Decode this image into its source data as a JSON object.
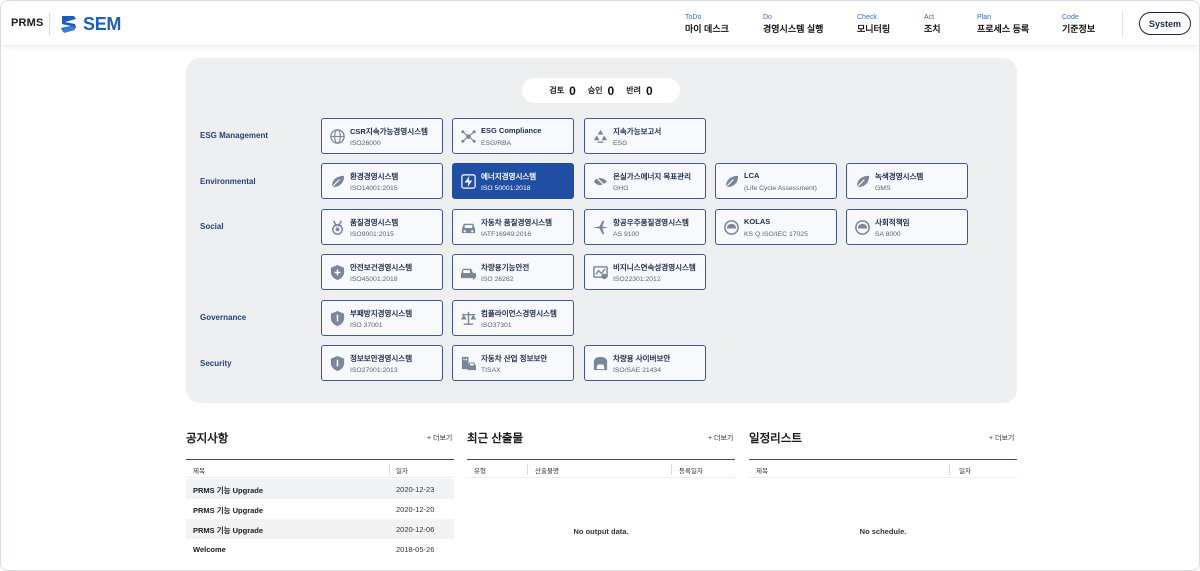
{
  "header": {
    "logo_text": "PRMS",
    "brand_text": "SEM",
    "nav": [
      {
        "en": "ToDo",
        "ko": "마이 데스크"
      },
      {
        "en": "Do",
        "ko": "경영시스템 실행"
      },
      {
        "en": "Check",
        "ko": "모니터링"
      },
      {
        "en": "Act",
        "ko": "조치"
      },
      {
        "en": "Plan",
        "ko": "프로세스 등록"
      },
      {
        "en": "Code",
        "ko": "기준정보"
      }
    ],
    "system_label": "System"
  },
  "counter": [
    {
      "label": "검토",
      "value": "0"
    },
    {
      "label": "승인",
      "value": "0"
    },
    {
      "label": "반려",
      "value": "0"
    }
  ],
  "categories": [
    "ESG Management",
    "Environmental",
    "Social",
    "Governance",
    "Security"
  ],
  "cards": [
    {
      "title": "CSR지속가능경영시스템",
      "code": "ISO26000",
      "icon": "globe-icon"
    },
    {
      "title": "ESG Compliance",
      "code": "ESG/RBA",
      "icon": "network-icon"
    },
    {
      "title": "지속가능보고서",
      "code": "ESG",
      "icon": "recycle-icon"
    },
    {
      "title": "환경경영시스템",
      "code": "ISO14001:2015",
      "icon": "leaf-icon"
    },
    {
      "title": "에너지경영시스템",
      "code": "ISO 50001:2018",
      "icon": "energy-icon",
      "active": true
    },
    {
      "title": "온실가스에너지 목표관리",
      "code": "GHG",
      "icon": "eco-leaf-icon"
    },
    {
      "title": "LCA",
      "code": "(Life Cycle Assessment)",
      "icon": "leaf-icon"
    },
    {
      "title": "녹색경영시스템",
      "code": "GMS",
      "icon": "green-leaf-icon"
    },
    {
      "title": "품질경영시스템",
      "code": "ISO9001:2015",
      "icon": "medal-icon"
    },
    {
      "title": "자동차 품질경영시스템",
      "code": "IATF16949:2016",
      "icon": "car-icon"
    },
    {
      "title": "항공우주품질경영시스템",
      "code": "AS 9100",
      "icon": "airplane-icon"
    },
    {
      "title": "KOLAS",
      "code": "KS Q ISO/IEC 17025",
      "icon": "gauge-icon"
    },
    {
      "title": "사회적책임",
      "code": "SA 8000",
      "icon": "gauge-icon"
    },
    {
      "title": "안전보건경영시스템",
      "code": "ISO45001:2018",
      "icon": "shield-plus-icon"
    },
    {
      "title": "차량용기능안전",
      "code": "ISO 26262",
      "icon": "vehicle-safety-icon"
    },
    {
      "title": "비지니스연속성경영시스템",
      "code": "ISO22301:2012",
      "icon": "continuity-icon"
    },
    {
      "title": "부패방지경영시스템",
      "code": "ISO 37001",
      "icon": "shield-icon"
    },
    {
      "title": "컴플라이언스경영시스템",
      "code": "ISO37301",
      "icon": "scale-icon"
    },
    {
      "title": "정보보안경영시스템",
      "code": "ISO27001:2013",
      "icon": "shield-icon"
    },
    {
      "title": "자동차 산업 정보보안",
      "code": "TISAX",
      "icon": "car-building-icon"
    },
    {
      "title": "차량용 사이버보안",
      "code": "ISO/SAE 21434",
      "icon": "cyber-car-icon"
    }
  ],
  "notices": {
    "title": "공지사항",
    "more": "+ 더보기",
    "columns": [
      "제목",
      "일자"
    ],
    "rows": [
      {
        "title": "PRMS 기능 Upgrade",
        "date": "2020-12-23"
      },
      {
        "title": "PRMS 기능 Upgrade",
        "date": "2020-12-20"
      },
      {
        "title": "PRMS 기능 Upgrade",
        "date": "2020-12-06"
      },
      {
        "title": "Welcome",
        "date": "2018-05-26"
      }
    ]
  },
  "outputs": {
    "title": "최근 산출물",
    "more": "+ 더보기",
    "columns": [
      "유형",
      "산출물명",
      "등록일자"
    ],
    "empty": "No output data."
  },
  "schedule": {
    "title": "일정리스트",
    "more": "+ 더보기",
    "columns": [
      "제목",
      "일자"
    ],
    "empty": "No schedule."
  },
  "colors": {
    "accent": "#1f4ea3",
    "brand": "#1d5fb5",
    "border": "#3d5899"
  }
}
